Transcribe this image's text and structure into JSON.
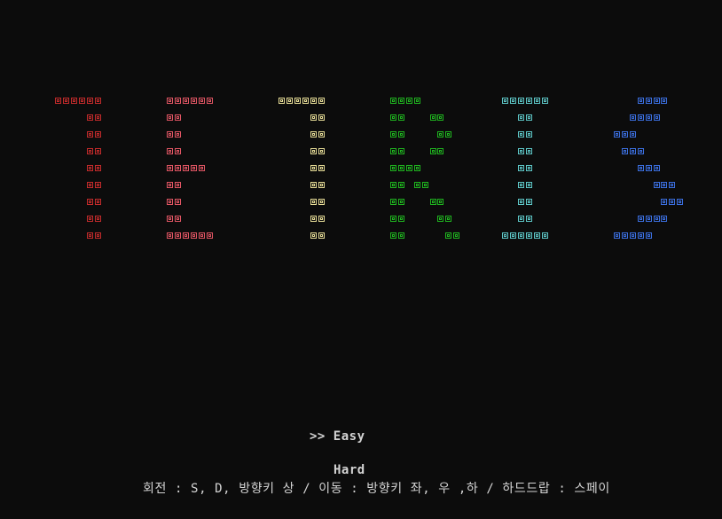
{
  "logo": {
    "word": "TETRIS",
    "letters": [
      {
        "char": "T",
        "color": "#c42b2b",
        "rows": [
          "###### ",
          "    ## ",
          "    ## ",
          "    ## ",
          "    ## ",
          "    ## ",
          "    ## ",
          "    ## ",
          "    ## "
        ]
      },
      {
        "char": "E",
        "color": "#e05563",
        "rows": [
          "###### ",
          "##     ",
          "##     ",
          "##     ",
          "#####  ",
          "##     ",
          "##     ",
          "##     ",
          "###### "
        ]
      },
      {
        "char": "T",
        "color": "#e8de98",
        "rows": [
          "###### ",
          "    ## ",
          "    ## ",
          "    ## ",
          "    ## ",
          "    ## ",
          "    ## ",
          "    ## ",
          "    ## "
        ]
      },
      {
        "char": "R",
        "color": "#1fb51f",
        "rows": [
          "####     ",
          "##   ##  ",
          "##    ## ",
          "##   ##  ",
          "####     ",
          "## ##    ",
          "##   ##  ",
          "##    ## ",
          "##     ##"
        ]
      },
      {
        "char": "I",
        "color": "#5ec8c8",
        "rows": [
          "###### ",
          "  ##   ",
          "  ##   ",
          "  ##   ",
          "  ##   ",
          "  ##   ",
          "  ##   ",
          "  ##   ",
          "###### "
        ]
      },
      {
        "char": "S",
        "color": "#3b6fe0",
        "rows": [
          "   ####   ",
          "  ####    ",
          "###       ",
          " ###      ",
          "   ###    ",
          "     ###  ",
          "      ### ",
          "   ####   ",
          "#####     "
        ]
      }
    ]
  },
  "menu": {
    "easy_label": ">> Easy",
    "hard_label": "Hard"
  },
  "help": {
    "text": "회전 : S, D, 방향키 상 / 이동 : 방향키 좌, 우 ,하 / 하드드랍 : 스페이"
  }
}
